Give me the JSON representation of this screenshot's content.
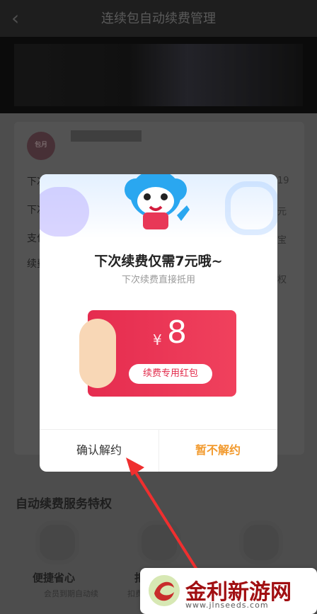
{
  "header": {
    "title": "连续包自动续费管理",
    "back_icon": "back-icon"
  },
  "background": {
    "badge": "包月",
    "rows_left": [
      "下次",
      "下次",
      "支付",
      "续费"
    ],
    "rows_right": [
      "19",
      "元",
      "宝",
      "权"
    ]
  },
  "features": {
    "section_title": "自动续费服务特权",
    "items": [
      {
        "label": "便捷省心",
        "sub": "会员到期自动续",
        "icon": "heart-shield-icon"
      },
      {
        "label": "扣",
        "sub": "扣费",
        "icon": "yen-shield-icon"
      },
      {
        "label": "",
        "sub": "",
        "icon": "check-shield-icon"
      }
    ]
  },
  "dialog": {
    "title": "下次续费仅需7元哦~",
    "subtitle": "下次续费直接抵用",
    "red_packet": {
      "currency": "¥",
      "amount": "8",
      "label": "续费专用红包"
    },
    "buttons": {
      "confirm": "确认解约",
      "cancel": "暂不解约"
    }
  },
  "watermark": {
    "name": "金利新游网",
    "url": "www.jlnseeds.com"
  }
}
